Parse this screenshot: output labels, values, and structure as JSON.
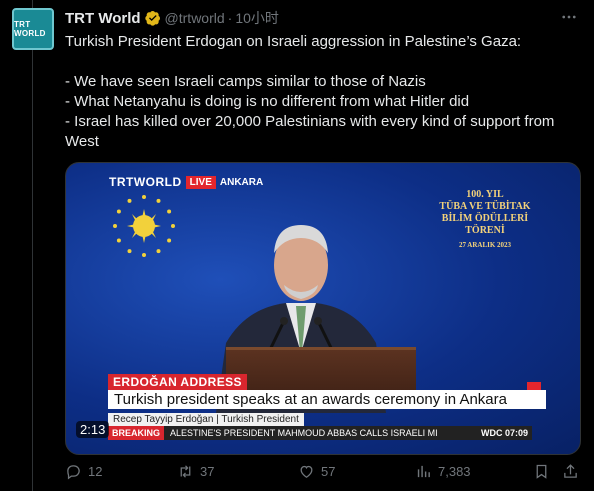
{
  "account": {
    "avatar_text": "TRT WORLD",
    "display_name": "TRT World",
    "handle": "@trtworld",
    "time": "10小时"
  },
  "tweet": {
    "lines": [
      "Turkish President Erdogan on Israeli aggression in Palestine’s Gaza:",
      "",
      "- We have seen Israeli camps similar to those of Nazis",
      "- What Netanyahu is doing is no different from what Hitler did",
      "- Israel has killed over 20,000 Palestinians with every kind of support from West"
    ]
  },
  "video": {
    "channel": "TRTWORLD",
    "live_badge": "LIVE",
    "location": "ANKARA",
    "event_title": [
      "100. YIL",
      "TÜBA VE TÜBİTAK",
      "BİLİM ÖDÜLLERİ",
      "TÖRENİ"
    ],
    "event_date": "27 ARALIK 2023",
    "lower_third_category": "ERDOĞAN ADDRESS",
    "lower_third_headline": "Turkish president speaks at an awards ceremony in Ankara",
    "lower_third_sub": "Recep Tayyip Erdoğan | Turkish President",
    "ticker_label": "BREAKING",
    "ticker_text": "ALESTINE'S PRESIDENT MAHMOUD ABBAS CALLS ISRAELI MI",
    "ticker_channel_time": "WDC 07:09",
    "duration": "2:13"
  },
  "actions": {
    "replies": "12",
    "reposts": "37",
    "likes": "57",
    "views": "7,383"
  },
  "colors": {
    "background": "#000000",
    "text": "#e7e9ea",
    "muted": "#71767b",
    "verified": "#e2b719",
    "brand_red": "#e3262d"
  }
}
